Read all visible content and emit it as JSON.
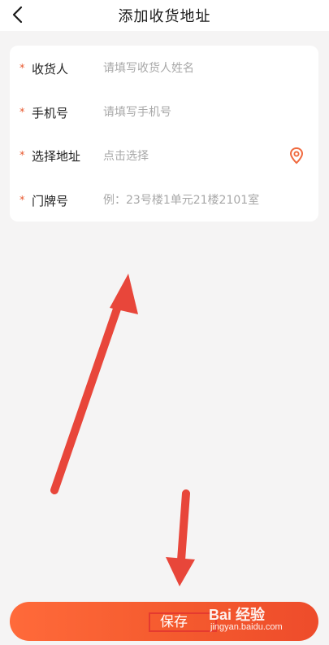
{
  "header": {
    "back_icon": "chevron-left-icon",
    "title": "添加收货地址"
  },
  "form": {
    "required_mark": "*",
    "consignee": {
      "label": "收货人",
      "placeholder": "请填写收货人姓名"
    },
    "phone": {
      "label": "手机号",
      "placeholder": "请填写手机号"
    },
    "address": {
      "label": "选择地址",
      "value": "点击选择",
      "icon": "location-pin-icon"
    },
    "door_number": {
      "label": "门牌号",
      "placeholder": "例：23号楼1单元21楼2101室"
    }
  },
  "footer": {
    "save_label": "保存"
  },
  "watermark": {
    "brand": "Bai 经验",
    "url": "jingyan.baidu.com"
  },
  "colors": {
    "accent": "#f45a2e",
    "required": "#e8582e",
    "annotation_arrow": "#e8463a"
  }
}
